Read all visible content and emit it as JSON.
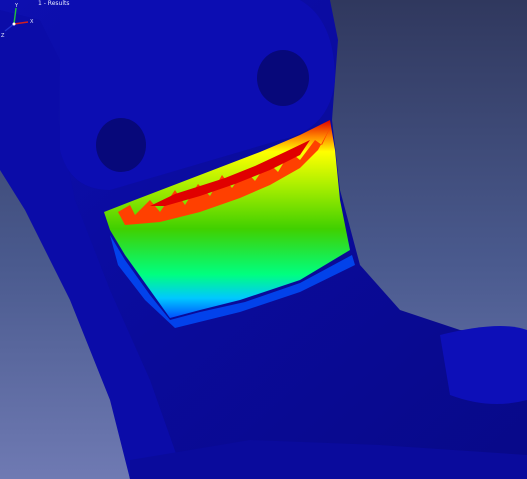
{
  "window": {
    "title": "1 - Results"
  },
  "viewport": {
    "background_top": "#30385e",
    "background_bottom": "#6f7ab3",
    "part_color": "#0a0b9a"
  },
  "axis_triad": {
    "x_label": "X",
    "y_label": "Y",
    "z_label": "Z",
    "x_color": "#d02020",
    "y_color": "#20c040",
    "z_color": "#2030d0"
  },
  "contour_colors": [
    "#0000a0",
    "#0050ff",
    "#00c8ff",
    "#00ff80",
    "#40d000",
    "#b0f000",
    "#ffff00",
    "#ff8000",
    "#e00000"
  ]
}
